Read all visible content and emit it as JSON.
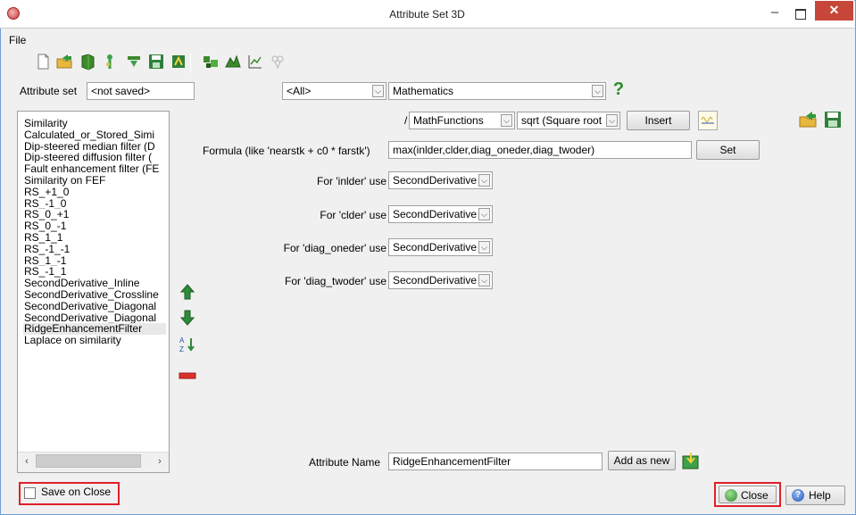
{
  "window": {
    "title": "Attribute Set 3D",
    "minimize_glyph": "–",
    "close_glyph": "✕"
  },
  "menu": {
    "file": "File"
  },
  "toolbar": {
    "icons": [
      "new-icon",
      "open-icon",
      "save-as-icon",
      "default-set-icon",
      "import-icon",
      "save-icon",
      "reload-icon",
      "tools-icon",
      "attribute-set-icon",
      "graph-icon",
      "settings-icon"
    ]
  },
  "attribute_set": {
    "label": "Attribute set",
    "value": "<not saved>"
  },
  "filters": {
    "category": "<All>",
    "type": "Mathematics"
  },
  "help_glyph": "?",
  "math": {
    "slash": "/",
    "functions": "MathFunctions",
    "function_choice": "sqrt (Square root",
    "insert_label": "Insert",
    "formula_label": "Formula (like 'nearstk + c0 * farstk')",
    "formula_value": "max(inlder,clder,diag_oneder,diag_twoder)",
    "set_label": "Set"
  },
  "inputs": [
    {
      "label": "For 'inlder' use",
      "value": "SecondDerivative"
    },
    {
      "label": "For 'clder' use",
      "value": "SecondDerivative"
    },
    {
      "label": "For 'diag_oneder' use",
      "value": "SecondDerivative"
    },
    {
      "label": "For 'diag_twoder' use",
      "value": "SecondDerivative"
    }
  ],
  "attributes": {
    "items": [
      "Similarity",
      "Calculated_or_Stored_Simi",
      "Dip-steered median filter (D",
      "Dip-steered diffusion filter (",
      "Fault enhancement filter (FE",
      "Similarity on FEF",
      "RS_+1_0",
      "RS_-1_0",
      "RS_0_+1",
      "RS_0_-1",
      "RS_1_1",
      "RS_-1_-1",
      "RS_1_-1",
      "RS_-1_1",
      "SecondDerivative_Inline",
      "SecondDerivative_Crossline",
      "SecondDerivative_Diagonal",
      "SecondDerivative_Diagonal",
      "RidgeEnhancementFilter",
      "Laplace on similarity"
    ],
    "selected_index": 18,
    "scroll_left": "‹",
    "scroll_right": "›"
  },
  "attribute_name": {
    "label": "Attribute Name",
    "value": "RidgeEnhancementFilter",
    "add_as_new_label": "Add as new"
  },
  "footer": {
    "save_on_close_label": "Save on Close",
    "save_on_close_checked": false,
    "close_label": "Close",
    "help_label": "Help"
  },
  "colors": {
    "highlight_border": "#e0202a",
    "title_close_bg": "#c7463a",
    "arrow_green": "#2e8b3a",
    "remove_red": "#d9322a"
  }
}
